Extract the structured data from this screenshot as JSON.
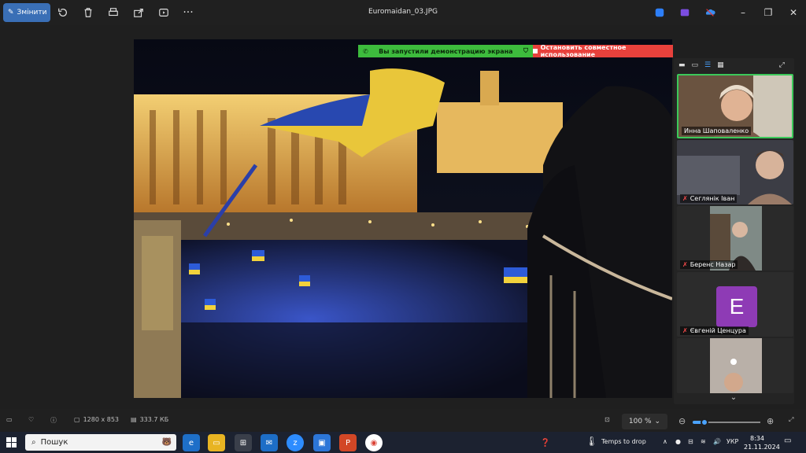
{
  "window": {
    "title": "Euromaidan_03.JPG",
    "edit_label": "Змінити"
  },
  "share_banner": {
    "started_text": "Вы запустили демонстрацию экрана",
    "stop_text": "Остановить совместное использование"
  },
  "participants": [
    {
      "name": "Инна Шаповаленко",
      "muted": false
    },
    {
      "name": "Сеглянік Іван",
      "muted": true
    },
    {
      "name": "Беренс Назар",
      "muted": true
    },
    {
      "name": "Євгеній Ценцура",
      "muted": true,
      "initial": "E"
    },
    {
      "name": "",
      "muted": true
    }
  ],
  "statusbar": {
    "dimensions": "1280 x 853",
    "size": "333.7 КБ",
    "zoom": "100 %"
  },
  "taskbar": {
    "search_placeholder": "Пошук",
    "weather": "Temps to drop",
    "language": "УКР",
    "time": "8:34",
    "date": "21.11.2024"
  },
  "colors": {
    "edit_button": "#3a6fb6",
    "share_green": "#3dbb3d",
    "share_red": "#e8413c",
    "avatar_purple": "#8e3bb5",
    "accent_blue": "#4aa3ff"
  }
}
